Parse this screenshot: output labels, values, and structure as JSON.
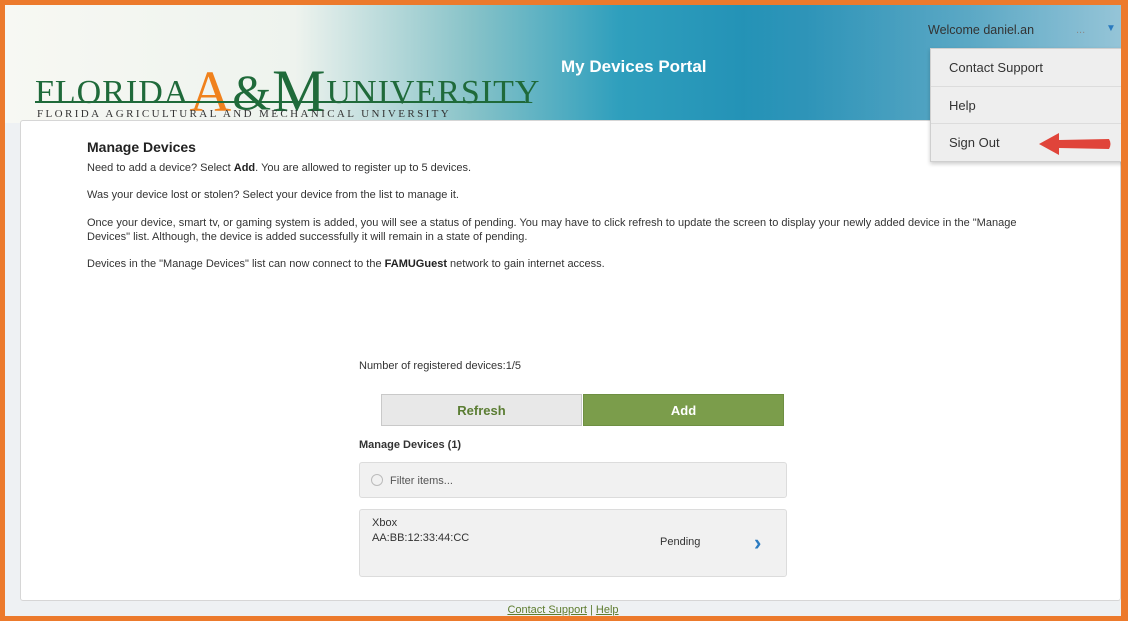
{
  "header": {
    "logo_words": {
      "florida": "FLORIDA",
      "a": "A",
      "amp": "&",
      "m": "M",
      "university": "UNIVERSITY"
    },
    "logo_subtitle": "FLORIDA AGRICULTURAL AND MECHANICAL UNIVERSITY",
    "portal_title": "My Devices Portal"
  },
  "user_menu": {
    "welcome": "Welcome daniel.an",
    "ellipsis": "...",
    "caret_icon": "caret-down-icon",
    "items": [
      {
        "label": "Contact Support"
      },
      {
        "label": "Help"
      },
      {
        "label": "Sign Out"
      }
    ]
  },
  "manage": {
    "title": "Manage Devices",
    "p1": {
      "a": "Need to add a device? Select ",
      "b": "Add",
      "c": ". You are allowed to register up to 5 devices."
    },
    "p2": "Was your device lost or stolen? Select your device from the list to manage it.",
    "p3": "Once your device, smart tv, or gaming system  is added, you will see a status of pending.  You may have to click refresh to update the screen to display your newly added device in the \"Manage Devices\" list.  Although, the device is added successfully it will remain in a state of pending.",
    "p4": {
      "a": "Devices in the \"Manage Devices\" list can now connect to the ",
      "b": "FAMUGuest",
      "c": " network to gain internet access."
    }
  },
  "devices": {
    "count_label": "Number of registered devices:1/5",
    "refresh_label": "Refresh",
    "add_label": "Add",
    "list_title": "Manage Devices  (1)",
    "filter_placeholder": "Filter items...",
    "items": [
      {
        "name": "Xbox",
        "mac": "AA:BB:12:33:44:CC",
        "status": "Pending"
      }
    ]
  },
  "footer": {
    "contact": "Contact Support",
    "sep": " | ",
    "help": "Help"
  },
  "colors": {
    "frame": "#ec7a2c",
    "accent_green": "#7b9d4b",
    "arrow_red": "#e0443a",
    "link_blue": "#2c7bc0"
  },
  "annotation": {
    "arrow": "red-arrow-pointing-left"
  }
}
